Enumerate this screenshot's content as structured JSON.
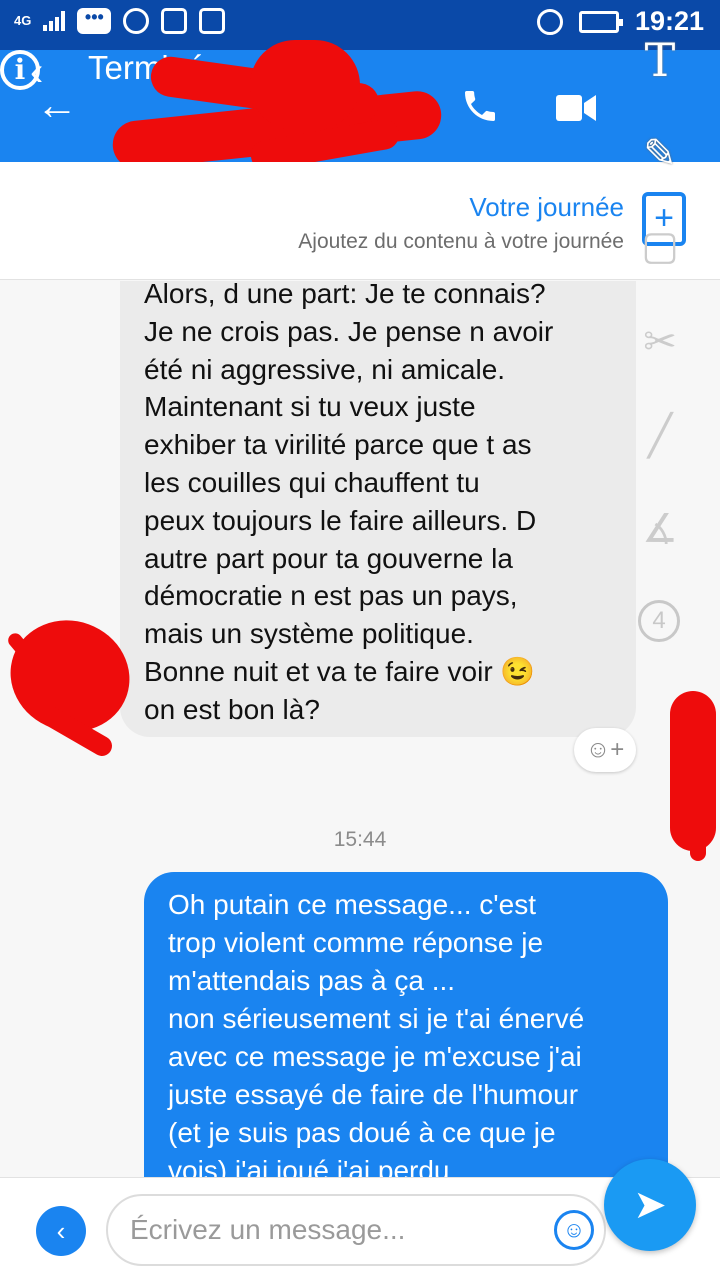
{
  "status_bar": {
    "network": "4G",
    "time": "19:21"
  },
  "header": {
    "done_label": "Terminé"
  },
  "story": {
    "title": "Votre journée",
    "subtitle": "Ajoutez du contenu à votre journée"
  },
  "messages": {
    "received": "Alors, d une part: Je te connais?\nJe ne crois pas. Je pense n avoir\nété ni aggressive, ni amicale.\nMaintenant si tu veux juste\nexhiber ta virilité parce que t as\nles couilles qui chauffent tu\npeux toujours le faire ailleurs. D\nautre part pour ta gouverne la\ndémocratie n est pas un pays,\nmais un système politique.\nBonne nuit et va te faire voir 😉\non est bon là?",
    "timestamp": "15:44",
    "sent": "Oh putain ce message... c'est\ntrop violent comme réponse je\nm'attendais pas à ça ...\nnon sérieusement si je t'ai énervé\navec ce message je m'excuse j'ai\njuste essayé de faire de l'humour\n(et je suis pas doué à ce que je\nvois) j'ai joué j'ai perdu"
  },
  "composer": {
    "placeholder": "Écrivez un message..."
  },
  "overlay_tools": {
    "text_tool": "T",
    "timer_value": "4"
  },
  "colors": {
    "header": "#1a84f0",
    "status_bar": "#0a49a8",
    "redaction": "#ee0c0c"
  }
}
